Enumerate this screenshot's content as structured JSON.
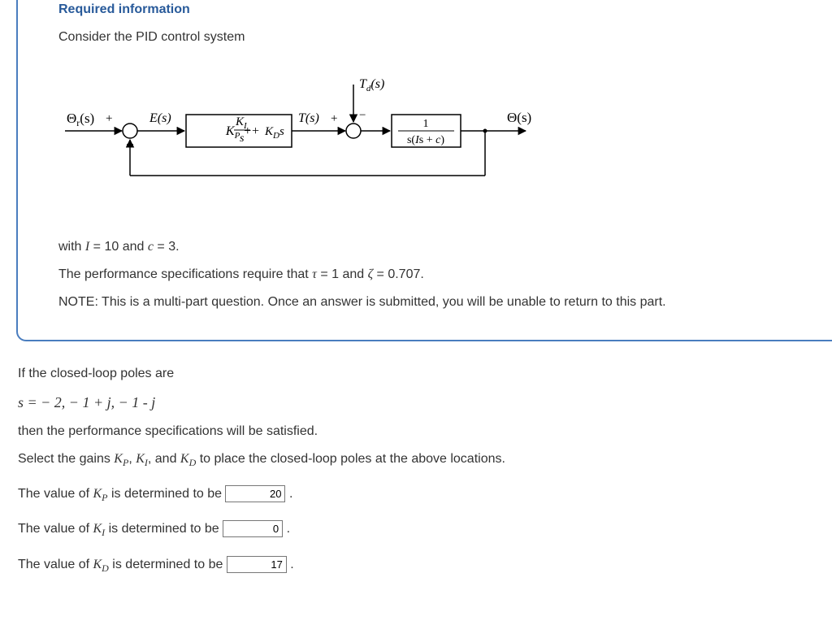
{
  "info": {
    "header": "Required information",
    "intro": "Consider the PID control system",
    "params": {
      "pre": "with ",
      "I": "I",
      "Ieq": " = 10 and ",
      "c": "c",
      "ceq": " = 3."
    },
    "specs": {
      "pre": "The performance specifications require that ",
      "tau": "τ",
      "taueq": " = 1 and ",
      "zeta": "ζ",
      "zetaeq": " = 0.707."
    },
    "note": "NOTE: This is a multi-part question. Once an answer is submitted, you will be unable to return to this part."
  },
  "question": {
    "poles_intro": "If the closed-loop poles are",
    "poles_math": "s =  − 2,   − 1 + j,   − 1 - j",
    "poles_outro": "then the performance specifications will be satisfied.",
    "select_prompt_pre": "Select the gains ",
    "select_prompt_post": " to place the closed-loop poles at the above locations.",
    "and": " and ",
    "comma": ", ",
    "kp_label_pre": "The value of ",
    "kp_sym": "K",
    "kp_sub": "P",
    "ki_sub": "I",
    "kd_sub": "D",
    "label_post": " is determined to be ",
    "period": " .",
    "values": {
      "kp": "20",
      "ki": "0",
      "kd": "17"
    }
  },
  "diagram": {
    "theta_r": "Θ",
    "r_sub": "r",
    "s_arg": "(s)",
    "plus": "+",
    "minus": "−",
    "E": "E(s)",
    "controller": {
      "kp": "K",
      "kp_sub": "P",
      "plus": " + ",
      "ki": "K",
      "ki_sub": "I",
      "over_s": "s",
      "kd": "K",
      "kd_sub": "D",
      "kds_s": "s"
    },
    "T": "T(s)",
    "Td": "T",
    "Td_sub": "d",
    "Td_arg": "(s)",
    "plant_num": "1",
    "plant_den_pre": "s(",
    "plant_I": "I",
    "plant_s": "s + ",
    "plant_c": "c",
    "plant_den_post": ")",
    "theta": "Θ(s)"
  }
}
